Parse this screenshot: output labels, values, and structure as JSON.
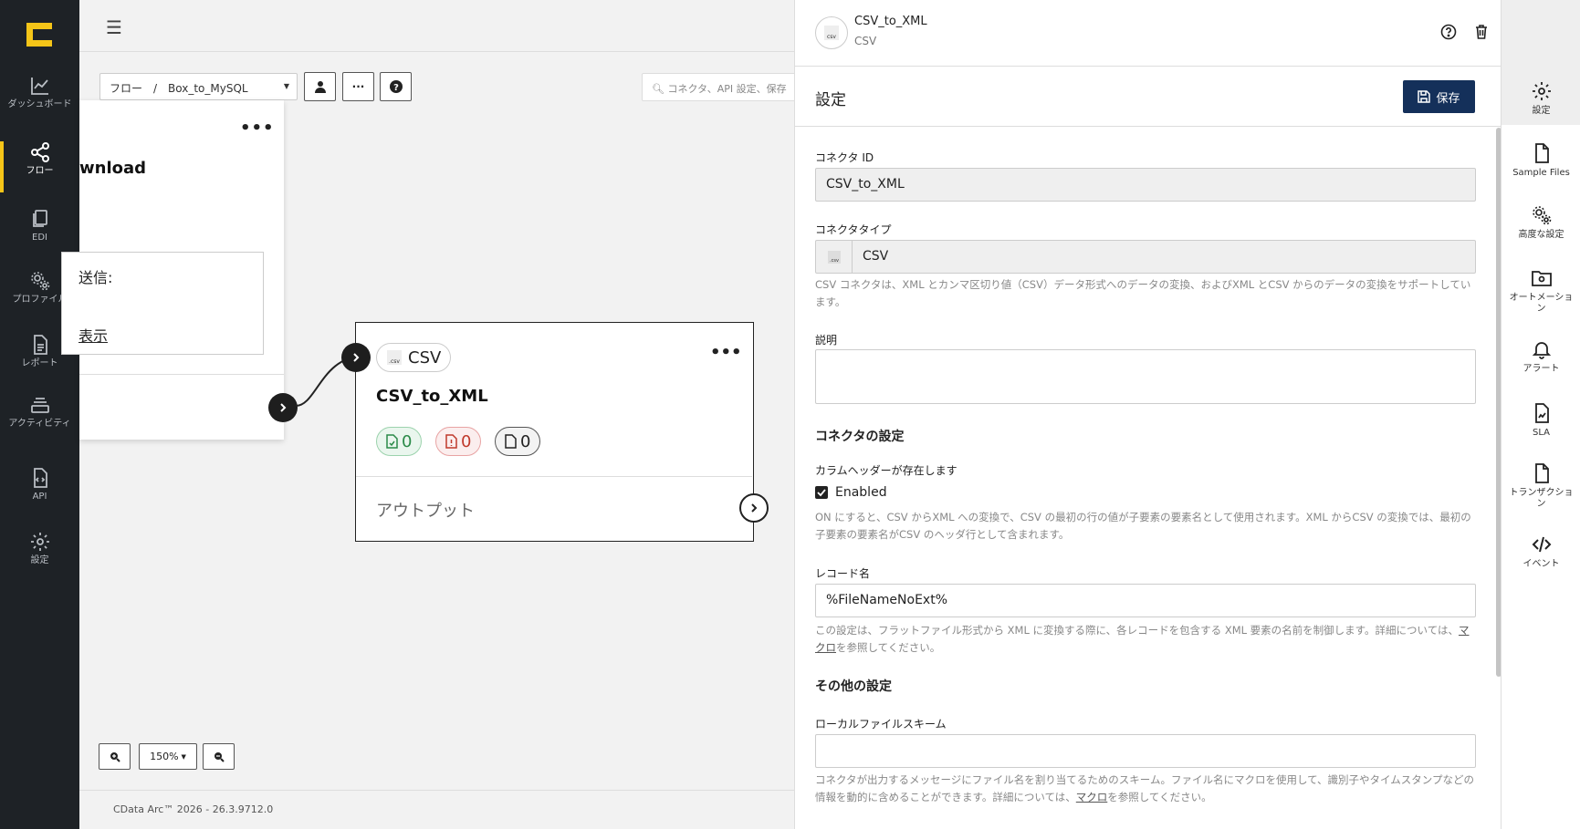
{
  "leftnav": {
    "items": [
      {
        "label": "ダッシュボード",
        "icon": "chart-line-icon"
      },
      {
        "label": "フロー",
        "icon": "share-nodes-icon"
      },
      {
        "label": "EDI",
        "icon": "documents-icon"
      },
      {
        "label": "プロファイル",
        "icon": "gears-icon"
      },
      {
        "label": "レポート",
        "icon": "report-icon"
      },
      {
        "label": "アクティビティ",
        "icon": "layers-icon"
      },
      {
        "label": "API",
        "icon": "file-code-icon"
      },
      {
        "label": "設定",
        "icon": "gear-icon"
      }
    ],
    "active": "フロー",
    "accent": "#f5c518"
  },
  "canvas": {
    "breadcrumb": "フロー　/　Box_to_MySQL",
    "search_placeholder": "コネクタ、API 設定、保存",
    "zoom_level": "150%",
    "version": "CData Arc™ 2026 - 26.3.9712.0",
    "node_left": {
      "title": "wnload",
      "info_line1": "送信:",
      "info_line2": "表示"
    },
    "node_csv": {
      "chip_label": "CSV",
      "title": "CSV_to_XML",
      "success_count": "0",
      "error_count": "0",
      "pending_count": "0",
      "output_label": "アウトプット"
    }
  },
  "panel": {
    "connector_name": "CSV_to_XML",
    "connector_type": "CSV",
    "settings_title": "設定",
    "save_label": "保存",
    "save_color": "#14305a",
    "fields": {
      "connector_id_label": "コネクタ ID",
      "connector_id_value": "CSV_to_XML",
      "connector_type_label": "コネクタタイプ",
      "connector_type_value": "CSV",
      "connector_type_help": "CSV コネクタは、XML とカンマ区切り値（CSV）データ形式へのデータの変換、およびXML とCSV からのデータの変換をサポートしています。",
      "description_label": "説明",
      "connector_settings_title": "コネクタの設定",
      "column_header_label": "カラムヘッダーが存在します",
      "enabled_label": "Enabled",
      "enabled_checked": true,
      "column_header_help": "ON にすると、CSV からXML への変換で、CSV の最初の行の値が子要素の要素名として使用されます。XML からCSV の変換では、最初の子要素の要素名がCSV のヘッダ行として含まれます。",
      "record_name_label": "レコード名",
      "record_name_value": "%FileNameNoExt%",
      "record_name_help_prefix": "この設定は、フラットファイル形式から XML に変換する際に、各レコードを包含する XML 要素の名前を制御します。詳細については、",
      "record_name_help_link": "マクロ",
      "record_name_help_suffix": "を参照してください。",
      "other_settings_title": "その他の設定",
      "local_file_scheme_label": "ローカルファイルスキーム",
      "local_file_scheme_value": "",
      "local_file_scheme_help_prefix": "コネクタが出力するメッセージにファイル名を割り当てるためのスキーム。ファイル名にマクロを使用して、識別子やタイムスタンプなどの情報を動的に含めることができます。詳細については、",
      "local_file_scheme_help_link": "マクロ",
      "local_file_scheme_help_suffix": "を参照してください。"
    }
  },
  "rail": {
    "items": [
      {
        "label": "設定",
        "icon": "gear-icon"
      },
      {
        "label": "Sample Files",
        "icon": "file-icon"
      },
      {
        "label": "高度な設定",
        "icon": "gears-icon"
      },
      {
        "label": "オートメーション",
        "icon": "folder-gear-icon"
      },
      {
        "label": "アラート",
        "icon": "bell-icon"
      },
      {
        "label": "SLA",
        "icon": "file-chart-icon"
      },
      {
        "label": "トランザクション",
        "icon": "file-icon"
      },
      {
        "label": "イベント",
        "icon": "code-icon"
      }
    ]
  }
}
